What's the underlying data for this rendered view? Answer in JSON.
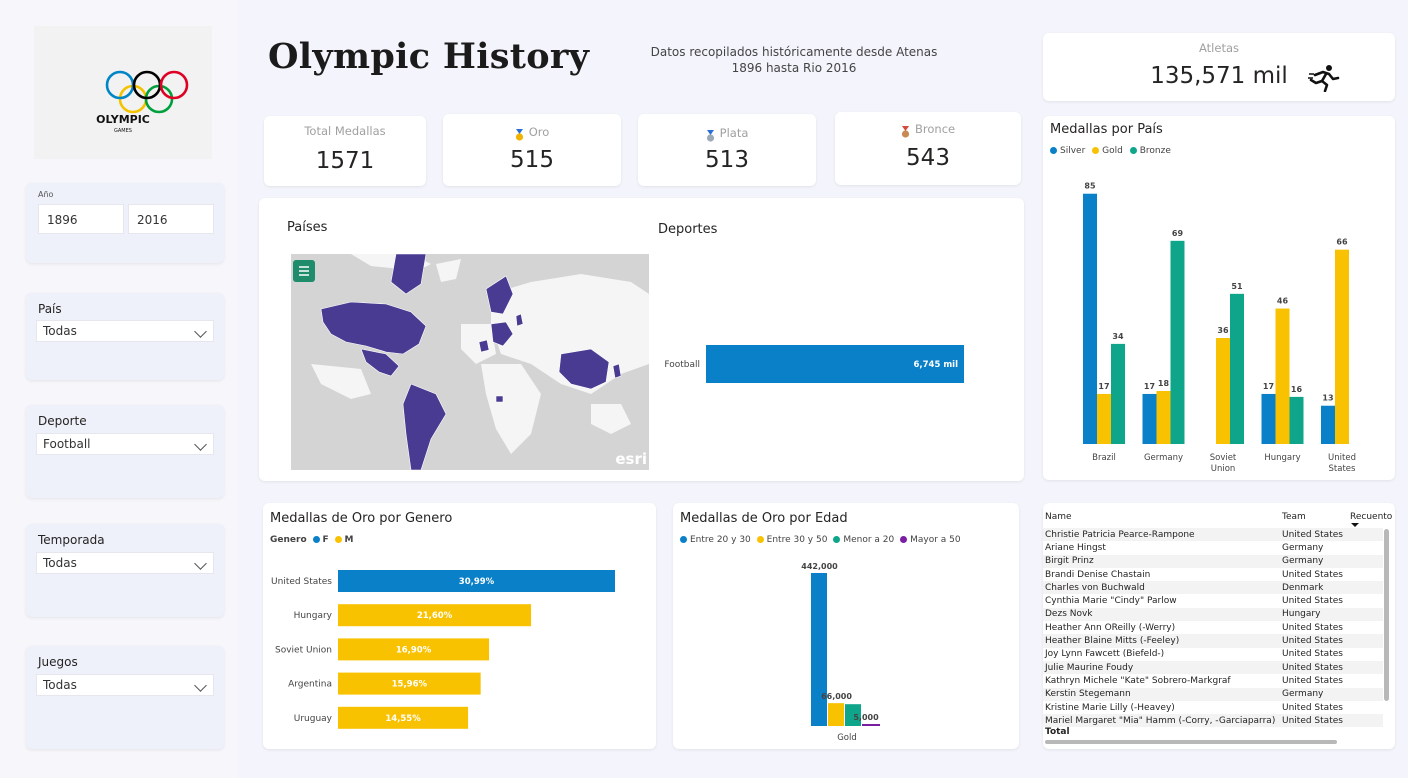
{
  "header": {
    "title": "Olympic History",
    "subtitle_line1": "Datos recopilados históricamente desde Atenas",
    "subtitle_line2": "1896 hasta Rio 2016"
  },
  "logo": {
    "text1": "OLYMPIC",
    "text2": "GAMES"
  },
  "filters": {
    "year": {
      "label": "Año",
      "from": "1896",
      "to": "2016"
    },
    "country": {
      "label": "País",
      "value": "Todas"
    },
    "sport": {
      "label": "Deporte",
      "value": "Football"
    },
    "season": {
      "label": "Temporada",
      "value": "Todas"
    },
    "games": {
      "label": "Juegos",
      "value": "Todas"
    }
  },
  "kpis": {
    "athletes": {
      "label": "Atletas",
      "value": "135,571 mil",
      "icon": "runner-icon"
    },
    "total": {
      "label": "Total Medallas",
      "value": "1571"
    },
    "gold": {
      "label": "Oro",
      "value": "515",
      "icon": "gold-medal-icon"
    },
    "silver": {
      "label": "Plata",
      "value": "513",
      "icon": "silver-medal-icon"
    },
    "bronze": {
      "label": "Bronce",
      "value": "543",
      "icon": "bronze-medal-icon"
    }
  },
  "map": {
    "title": "Países",
    "watermark": "esri",
    "menu_icon": "menu-icon"
  },
  "sports": {
    "title": "Deportes",
    "category": "Football",
    "value_label": "6,745 mil",
    "fraction": 1.0
  },
  "colors": {
    "blue": "#0a80c8",
    "gold": "#f9c200",
    "green": "#0ea58a",
    "purple": "#5a3d9a",
    "map_bg": "#d4d4d4",
    "map_land": "#f5f5f5"
  },
  "chart_data": [
    {
      "type": "bar",
      "title": "Medallas por País",
      "categories": [
        "Brazil",
        "Germany",
        "Soviet Union",
        "Hungary",
        "United States"
      ],
      "series": [
        {
          "name": "Silver",
          "color": "#0a80c8",
          "values": [
            85,
            17,
            null,
            17,
            13
          ]
        },
        {
          "name": "Gold",
          "color": "#f9c200",
          "values": [
            17,
            18,
            36,
            46,
            66
          ]
        },
        {
          "name": "Bronze",
          "color": "#0ea58a",
          "values": [
            34,
            69,
            51,
            16,
            null
          ]
        }
      ],
      "ylim": [
        0,
        90
      ]
    },
    {
      "type": "bar",
      "orientation": "horizontal",
      "title": "Medallas de Oro por Genero",
      "legend_title": "Genero",
      "legend": [
        {
          "name": "F",
          "color": "#0a80c8"
        },
        {
          "name": "M",
          "color": "#f9c200"
        }
      ],
      "categories": [
        "United States",
        "Hungary",
        "Soviet Union",
        "Argentina",
        "Uruguay"
      ],
      "values": [
        30.99,
        21.6,
        16.9,
        15.96,
        14.55
      ],
      "labels": [
        "30,99%",
        "21,60%",
        "16,90%",
        "15,96%",
        "14,55%"
      ],
      "colors": [
        "#0a80c8",
        "#f9c200",
        "#f9c200",
        "#f9c200",
        "#f9c200"
      ],
      "xlim": [
        0,
        35
      ]
    },
    {
      "type": "bar",
      "title": "Medallas de Oro por Edad",
      "categories": [
        "Gold"
      ],
      "series": [
        {
          "name": "Entre 20 y 30",
          "color": "#0a80c8",
          "values": [
            442000
          ],
          "label": "442,000"
        },
        {
          "name": "Entre 30 y 50",
          "color": "#f9c200",
          "values": [
            66000
          ],
          "label": "66,000"
        },
        {
          "name": "Menor a 20",
          "color": "#0ea58a",
          "values": [
            63000
          ],
          "label": ""
        },
        {
          "name": "Mayor a 50",
          "color": "#7b1fa2",
          "values": [
            5000
          ],
          "label": "5,000"
        }
      ],
      "ylim": [
        0,
        442000
      ]
    }
  ],
  "table": {
    "columns": [
      "Name",
      "Team",
      "Recuento"
    ],
    "rows": [
      [
        "Christie Patricia Pearce-Rampone",
        "United States"
      ],
      [
        "Ariane Hingst",
        "Germany"
      ],
      [
        "Birgit Prinz",
        "Germany"
      ],
      [
        "Brandi Denise Chastain",
        "United States"
      ],
      [
        "Charles von Buchwald",
        "Denmark"
      ],
      [
        "Cynthia Marie \"Cindy\" Parlow",
        "United States"
      ],
      [
        "Dezs Novk",
        "Hungary"
      ],
      [
        "Heather Ann OReilly (-Werry)",
        "United States"
      ],
      [
        "Heather Blaine Mitts (-Feeley)",
        "United States"
      ],
      [
        "Joy Lynn Fawcett (Biefeld-)",
        "United States"
      ],
      [
        "Julie Maurine Foudy",
        "United States"
      ],
      [
        "Kathryn Michele \"Kate\" Sobrero-Markgraf",
        "United States"
      ],
      [
        "Kerstin Stegemann",
        "Germany"
      ],
      [
        "Kristine Marie Lilly (-Heavey)",
        "United States"
      ],
      [
        "Mariel Margaret \"Mia\" Hamm (-Corry, -Garciaparra)",
        "United States"
      ]
    ],
    "total_label": "Total"
  }
}
